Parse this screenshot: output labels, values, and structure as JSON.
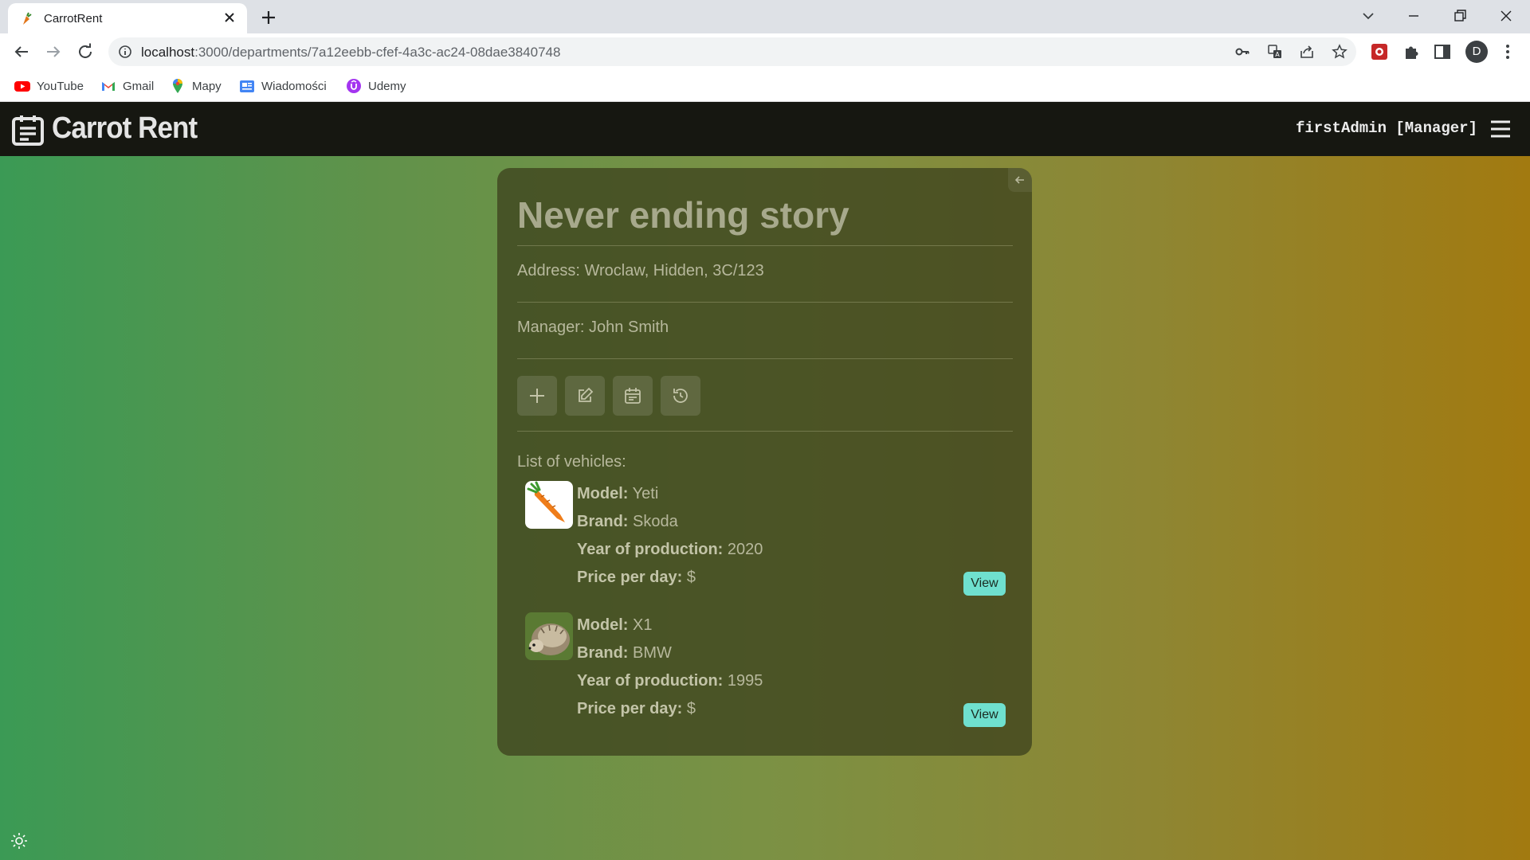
{
  "browser": {
    "tab_title": "CarrotRent",
    "url_host": "localhost",
    "url_rest": ":3000/departments/7a12eebb-cfef-4a3c-ac24-08dae3840748",
    "profile_initial": "D",
    "bookmarks": [
      {
        "label": "YouTube",
        "icon": "youtube-icon"
      },
      {
        "label": "Gmail",
        "icon": "gmail-icon"
      },
      {
        "label": "Mapy",
        "icon": "maps-icon"
      },
      {
        "label": "Wiadomości",
        "icon": "news-icon"
      },
      {
        "label": "Udemy",
        "icon": "udemy-icon"
      }
    ]
  },
  "app": {
    "brand": "Carrot Rent",
    "user": "firstAdmin [Manager]"
  },
  "department": {
    "name": "Never ending story",
    "address": "Address: Wroclaw, Hidden, 3C/123",
    "manager": "Manager: John Smith",
    "list_title": "List of vehicles:",
    "labels": {
      "model": "Model:",
      "brand": "Brand:",
      "year": "Year of production:",
      "price": "Price per day:"
    },
    "vehicles": [
      {
        "model": "Yeti",
        "brand": "Skoda",
        "year": "2020",
        "price": "$",
        "image": "carrot",
        "view_label": "View"
      },
      {
        "model": "X1",
        "brand": "BMW",
        "year": "1995",
        "price": "$",
        "image": "hedgehog",
        "view_label": "View"
      }
    ]
  },
  "colors": {
    "navbar": "#161711",
    "view_button": "#6fe0cf",
    "gradient_left": "#3b9a55",
    "gradient_right": "#a27a10"
  }
}
